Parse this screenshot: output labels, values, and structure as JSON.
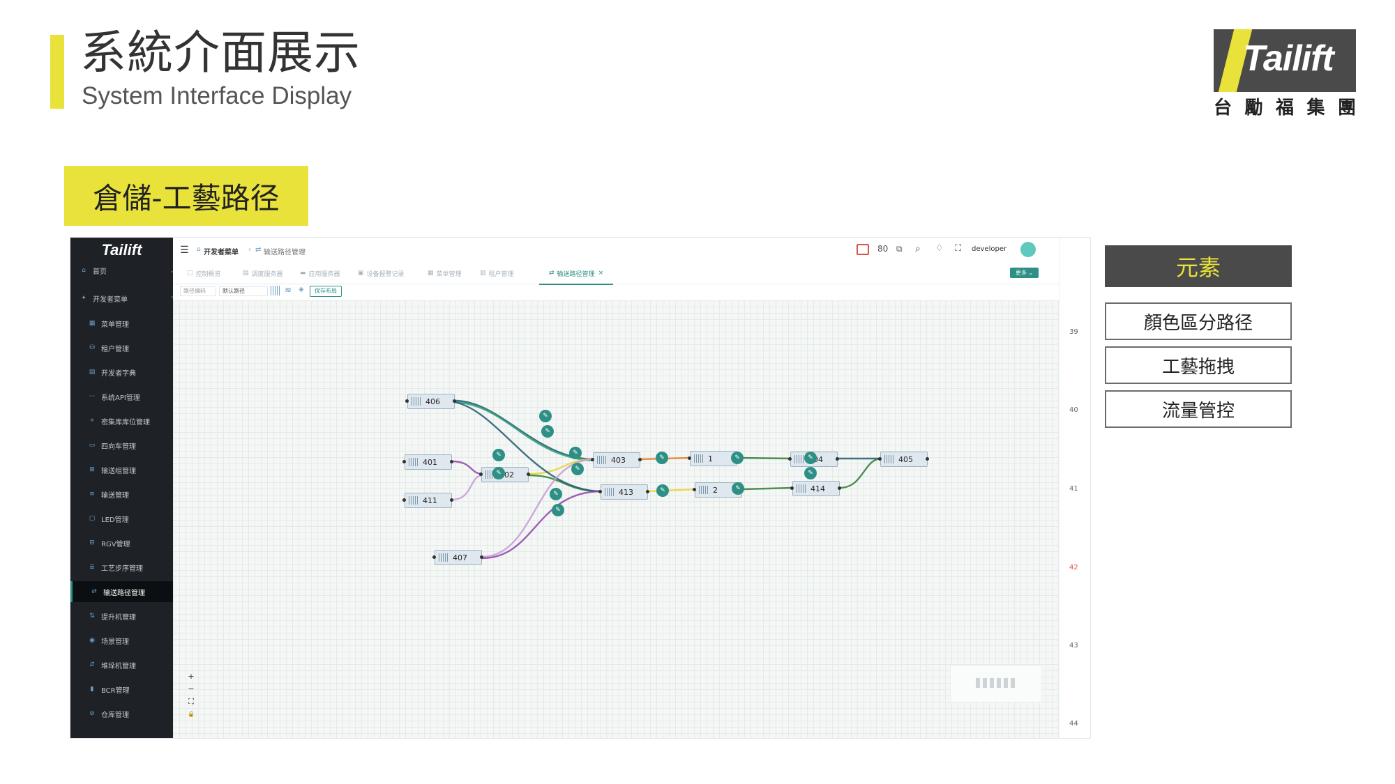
{
  "slide": {
    "title": "系統介面展示",
    "subtitle": "System Interface Display",
    "section_tag": "倉儲-工藝路径",
    "brand": {
      "logo_text": "Tailift",
      "chinese_chars": [
        "台",
        "勵",
        "福",
        "集",
        "團"
      ]
    }
  },
  "elements_panel": {
    "header": "元素",
    "items": [
      "顏色區分路径",
      "工藝拖拽",
      "流量管控"
    ]
  },
  "app": {
    "logo": "Tailift",
    "sidebar": {
      "items": [
        {
          "label": "首页",
          "icon": "home-icon",
          "level": 1,
          "chevron": "⌄"
        },
        {
          "label": "开发者菜单",
          "icon": "dev-icon",
          "level": 1,
          "chevron": "⌃"
        },
        {
          "label": "菜单管理",
          "icon": "menu-icon",
          "level": 2
        },
        {
          "label": "租户管理",
          "icon": "tenant-icon",
          "level": 2
        },
        {
          "label": "开发者字典",
          "icon": "dict-icon",
          "level": 2
        },
        {
          "label": "系统API管理",
          "icon": "api-icon",
          "level": 2
        },
        {
          "label": "密集库库位管理",
          "icon": "location-icon",
          "level": 2
        },
        {
          "label": "四向车管理",
          "icon": "shuttle-icon",
          "level": 2
        },
        {
          "label": "输送组管理",
          "icon": "group-icon",
          "level": 2
        },
        {
          "label": "输送管理",
          "icon": "conveyor-icon",
          "level": 2
        },
        {
          "label": "LED管理",
          "icon": "led-icon",
          "level": 2
        },
        {
          "label": "RGV管理",
          "icon": "rgv-icon",
          "level": 2
        },
        {
          "label": "工艺步序管理",
          "icon": "process-icon",
          "level": 2
        },
        {
          "label": "输送路径管理",
          "icon": "route-icon",
          "level": 2,
          "active": true
        },
        {
          "label": "提升机管理",
          "icon": "lift-icon",
          "level": 2
        },
        {
          "label": "场景管理",
          "icon": "scene-icon",
          "level": 2
        },
        {
          "label": "堆垛机管理",
          "icon": "stacker-icon",
          "level": 2
        },
        {
          "label": "BCR管理",
          "icon": "bcr-icon",
          "level": 2
        },
        {
          "label": "仓库管理",
          "icon": "warehouse-icon",
          "level": 2
        }
      ]
    },
    "breadcrumb": [
      "开发者菜单",
      "输送路径管理"
    ],
    "user": "developer",
    "tabs": [
      "控制概览",
      "调度服务器",
      "应用服务器",
      "设备报警记录",
      "菜单管理",
      "租户管理",
      "输送路径管理"
    ],
    "active_tab": "输送路径管理",
    "more_button": "更多 ⌄",
    "toolbar": {
      "route_code_label": "路径编码",
      "route_select_value": "默认路径",
      "save_layout": "保存布局"
    },
    "right_numbers": [
      "39",
      "40",
      "41",
      "42",
      "43",
      "44"
    ],
    "right_number_colors": [
      "#666666",
      "#666666",
      "#666666",
      "#d9534f",
      "#666666",
      "#666666"
    ],
    "zoom_controls": [
      "+",
      "−",
      "⛶",
      "🔒"
    ],
    "nodes": [
      "406",
      "401",
      "411",
      "402",
      "407",
      "403",
      "413",
      "1",
      "2",
      "404",
      "414",
      "405"
    ],
    "edge_colors": [
      "#1f5a6e",
      "#2a9d75",
      "#8e44ad",
      "#e67e22",
      "#e8d33a",
      "#c59bd6",
      "#2e7d32"
    ]
  }
}
